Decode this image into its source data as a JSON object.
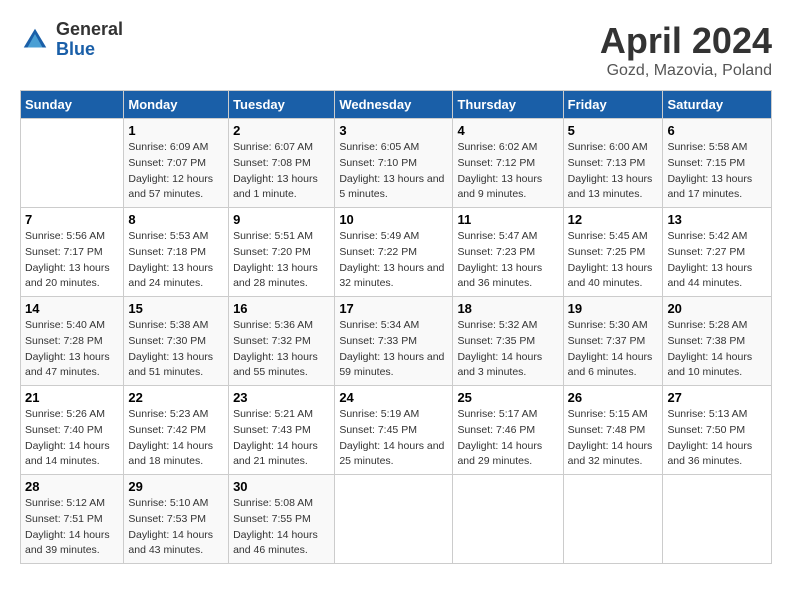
{
  "logo": {
    "general": "General",
    "blue": "Blue"
  },
  "title": "April 2024",
  "subtitle": "Gozd, Mazovia, Poland",
  "headers": [
    "Sunday",
    "Monday",
    "Tuesday",
    "Wednesday",
    "Thursday",
    "Friday",
    "Saturday"
  ],
  "weeks": [
    [
      {
        "day": "",
        "sunrise": "",
        "sunset": "",
        "daylight": ""
      },
      {
        "day": "1",
        "sunrise": "Sunrise: 6:09 AM",
        "sunset": "Sunset: 7:07 PM",
        "daylight": "Daylight: 12 hours and 57 minutes."
      },
      {
        "day": "2",
        "sunrise": "Sunrise: 6:07 AM",
        "sunset": "Sunset: 7:08 PM",
        "daylight": "Daylight: 13 hours and 1 minute."
      },
      {
        "day": "3",
        "sunrise": "Sunrise: 6:05 AM",
        "sunset": "Sunset: 7:10 PM",
        "daylight": "Daylight: 13 hours and 5 minutes."
      },
      {
        "day": "4",
        "sunrise": "Sunrise: 6:02 AM",
        "sunset": "Sunset: 7:12 PM",
        "daylight": "Daylight: 13 hours and 9 minutes."
      },
      {
        "day": "5",
        "sunrise": "Sunrise: 6:00 AM",
        "sunset": "Sunset: 7:13 PM",
        "daylight": "Daylight: 13 hours and 13 minutes."
      },
      {
        "day": "6",
        "sunrise": "Sunrise: 5:58 AM",
        "sunset": "Sunset: 7:15 PM",
        "daylight": "Daylight: 13 hours and 17 minutes."
      }
    ],
    [
      {
        "day": "7",
        "sunrise": "Sunrise: 5:56 AM",
        "sunset": "Sunset: 7:17 PM",
        "daylight": "Daylight: 13 hours and 20 minutes."
      },
      {
        "day": "8",
        "sunrise": "Sunrise: 5:53 AM",
        "sunset": "Sunset: 7:18 PM",
        "daylight": "Daylight: 13 hours and 24 minutes."
      },
      {
        "day": "9",
        "sunrise": "Sunrise: 5:51 AM",
        "sunset": "Sunset: 7:20 PM",
        "daylight": "Daylight: 13 hours and 28 minutes."
      },
      {
        "day": "10",
        "sunrise": "Sunrise: 5:49 AM",
        "sunset": "Sunset: 7:22 PM",
        "daylight": "Daylight: 13 hours and 32 minutes."
      },
      {
        "day": "11",
        "sunrise": "Sunrise: 5:47 AM",
        "sunset": "Sunset: 7:23 PM",
        "daylight": "Daylight: 13 hours and 36 minutes."
      },
      {
        "day": "12",
        "sunrise": "Sunrise: 5:45 AM",
        "sunset": "Sunset: 7:25 PM",
        "daylight": "Daylight: 13 hours and 40 minutes."
      },
      {
        "day": "13",
        "sunrise": "Sunrise: 5:42 AM",
        "sunset": "Sunset: 7:27 PM",
        "daylight": "Daylight: 13 hours and 44 minutes."
      }
    ],
    [
      {
        "day": "14",
        "sunrise": "Sunrise: 5:40 AM",
        "sunset": "Sunset: 7:28 PM",
        "daylight": "Daylight: 13 hours and 47 minutes."
      },
      {
        "day": "15",
        "sunrise": "Sunrise: 5:38 AM",
        "sunset": "Sunset: 7:30 PM",
        "daylight": "Daylight: 13 hours and 51 minutes."
      },
      {
        "day": "16",
        "sunrise": "Sunrise: 5:36 AM",
        "sunset": "Sunset: 7:32 PM",
        "daylight": "Daylight: 13 hours and 55 minutes."
      },
      {
        "day": "17",
        "sunrise": "Sunrise: 5:34 AM",
        "sunset": "Sunset: 7:33 PM",
        "daylight": "Daylight: 13 hours and 59 minutes."
      },
      {
        "day": "18",
        "sunrise": "Sunrise: 5:32 AM",
        "sunset": "Sunset: 7:35 PM",
        "daylight": "Daylight: 14 hours and 3 minutes."
      },
      {
        "day": "19",
        "sunrise": "Sunrise: 5:30 AM",
        "sunset": "Sunset: 7:37 PM",
        "daylight": "Daylight: 14 hours and 6 minutes."
      },
      {
        "day": "20",
        "sunrise": "Sunrise: 5:28 AM",
        "sunset": "Sunset: 7:38 PM",
        "daylight": "Daylight: 14 hours and 10 minutes."
      }
    ],
    [
      {
        "day": "21",
        "sunrise": "Sunrise: 5:26 AM",
        "sunset": "Sunset: 7:40 PM",
        "daylight": "Daylight: 14 hours and 14 minutes."
      },
      {
        "day": "22",
        "sunrise": "Sunrise: 5:23 AM",
        "sunset": "Sunset: 7:42 PM",
        "daylight": "Daylight: 14 hours and 18 minutes."
      },
      {
        "day": "23",
        "sunrise": "Sunrise: 5:21 AM",
        "sunset": "Sunset: 7:43 PM",
        "daylight": "Daylight: 14 hours and 21 minutes."
      },
      {
        "day": "24",
        "sunrise": "Sunrise: 5:19 AM",
        "sunset": "Sunset: 7:45 PM",
        "daylight": "Daylight: 14 hours and 25 minutes."
      },
      {
        "day": "25",
        "sunrise": "Sunrise: 5:17 AM",
        "sunset": "Sunset: 7:46 PM",
        "daylight": "Daylight: 14 hours and 29 minutes."
      },
      {
        "day": "26",
        "sunrise": "Sunrise: 5:15 AM",
        "sunset": "Sunset: 7:48 PM",
        "daylight": "Daylight: 14 hours and 32 minutes."
      },
      {
        "day": "27",
        "sunrise": "Sunrise: 5:13 AM",
        "sunset": "Sunset: 7:50 PM",
        "daylight": "Daylight: 14 hours and 36 minutes."
      }
    ],
    [
      {
        "day": "28",
        "sunrise": "Sunrise: 5:12 AM",
        "sunset": "Sunset: 7:51 PM",
        "daylight": "Daylight: 14 hours and 39 minutes."
      },
      {
        "day": "29",
        "sunrise": "Sunrise: 5:10 AM",
        "sunset": "Sunset: 7:53 PM",
        "daylight": "Daylight: 14 hours and 43 minutes."
      },
      {
        "day": "30",
        "sunrise": "Sunrise: 5:08 AM",
        "sunset": "Sunset: 7:55 PM",
        "daylight": "Daylight: 14 hours and 46 minutes."
      },
      {
        "day": "",
        "sunrise": "",
        "sunset": "",
        "daylight": ""
      },
      {
        "day": "",
        "sunrise": "",
        "sunset": "",
        "daylight": ""
      },
      {
        "day": "",
        "sunrise": "",
        "sunset": "",
        "daylight": ""
      },
      {
        "day": "",
        "sunrise": "",
        "sunset": "",
        "daylight": ""
      }
    ]
  ]
}
